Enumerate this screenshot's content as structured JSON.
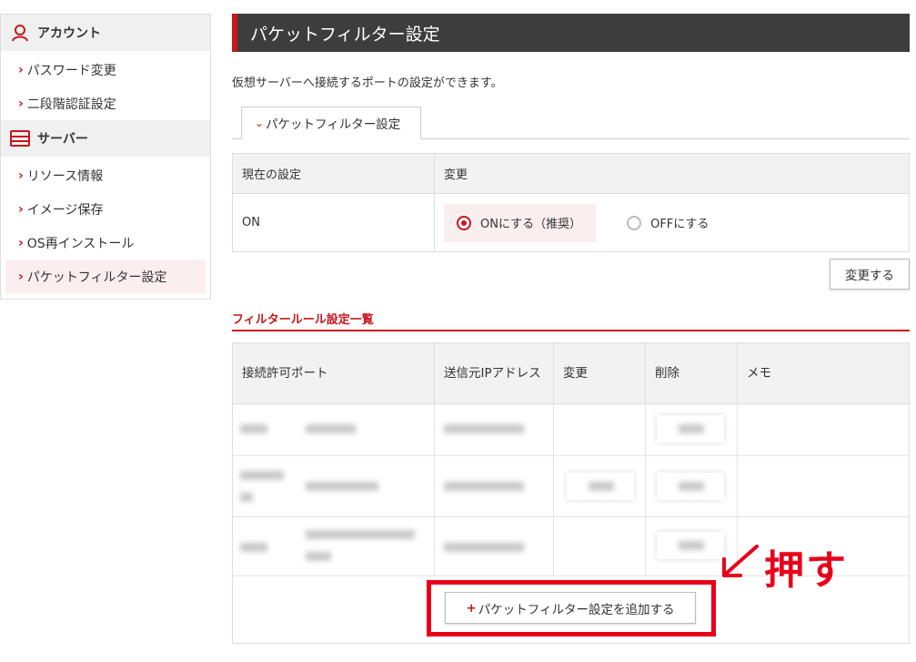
{
  "sidebar": {
    "account_heading": "アカウント",
    "account_items": [
      {
        "label": "パスワード変更"
      },
      {
        "label": "二段階認証設定"
      }
    ],
    "server_heading": "サーバー",
    "server_items": [
      {
        "label": "リソース情報"
      },
      {
        "label": "イメージ保存"
      },
      {
        "label": "OS再インストール"
      },
      {
        "label": "パケットフィルター設定",
        "active": true
      }
    ]
  },
  "main": {
    "title": "パケットフィルター設定",
    "description": "仮想サーバーへ接続するポートの設定ができます。",
    "tab_label": "パケットフィルター設定",
    "settings": {
      "col_current": "現在の設定",
      "col_change": "変更",
      "current_value": "ON",
      "option_on": "ONにする（推奨）",
      "option_off": "OFFにする",
      "selected": "on"
    },
    "change_button": "変更する",
    "rules_section_title": "フィルタールール設定一覧",
    "rules_table": {
      "headers": [
        "接続許可ポート",
        "送信元IPアドレス",
        "変更",
        "削除",
        "メモ"
      ]
    },
    "add_button": "パケットフィルター設定を追加する"
  },
  "annotation": {
    "text": "押す"
  },
  "colors": {
    "accent": "#c8161d",
    "annotation": "#e8001b",
    "title_bg": "#3d3d3d"
  }
}
